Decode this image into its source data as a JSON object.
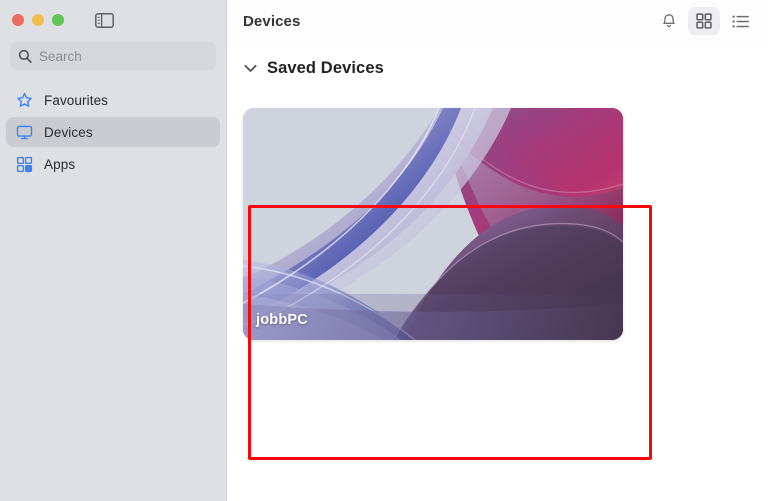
{
  "window": {
    "traffic_lights": [
      {
        "name": "close",
        "color": "#ed6a5e"
      },
      {
        "name": "minimize",
        "color": "#f5bd4f"
      },
      {
        "name": "zoom",
        "color": "#61c554"
      }
    ],
    "sidebar_toggle_icon": "sidebar-toggle-icon"
  },
  "search": {
    "placeholder": "Search",
    "value": "",
    "icon": "search-icon"
  },
  "sidebar": {
    "items": [
      {
        "label": "Favourites",
        "icon": "star-icon",
        "selected": false
      },
      {
        "label": "Devices",
        "icon": "monitor-icon",
        "selected": true
      },
      {
        "label": "Apps",
        "icon": "apps-grid-icon",
        "selected": false
      }
    ]
  },
  "header": {
    "title": "Devices",
    "actions": [
      {
        "name": "notifications-button",
        "icon": "bell-icon",
        "active": false
      },
      {
        "name": "grid-view-button",
        "icon": "grid-view-icon",
        "active": true
      },
      {
        "name": "list-view-button",
        "icon": "list-view-icon",
        "active": false
      }
    ]
  },
  "main": {
    "section": {
      "title": "Saved Devices",
      "expanded": true,
      "chevron_icon": "chevron-down-icon"
    },
    "devices": [
      {
        "name": "jobbPC",
        "thumbnail": "bloom-wallpaper"
      }
    ]
  },
  "annotation": {
    "highlight_color": "#fb0707",
    "target": "jobbPC device card"
  },
  "colors": {
    "sidebar_bg": "#dfe0e4",
    "sidebar_selected": "#cbccd1",
    "search_bg": "#d6d7db",
    "accent_blue": "#3b82f6",
    "main_bg": "#ffffff",
    "title_text": "#34343a"
  }
}
